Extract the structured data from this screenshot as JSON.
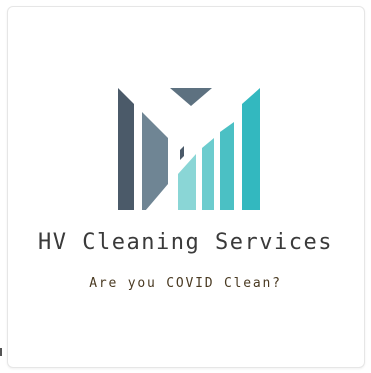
{
  "brand": {
    "name": "HV Cleaning Services",
    "tagline": "Are you COVID Clean?"
  },
  "colors": {
    "dark_slate": "#4b5a69",
    "mid_slate": "#6f8594",
    "light_teal": "#7fd1d1",
    "teal": "#44bcc1",
    "bright_teal": "#33b8bf",
    "name_text": "#3a3a3a",
    "tagline_text": "#4a3a22"
  },
  "logo": {
    "icon": "building-bars-logo-icon"
  }
}
